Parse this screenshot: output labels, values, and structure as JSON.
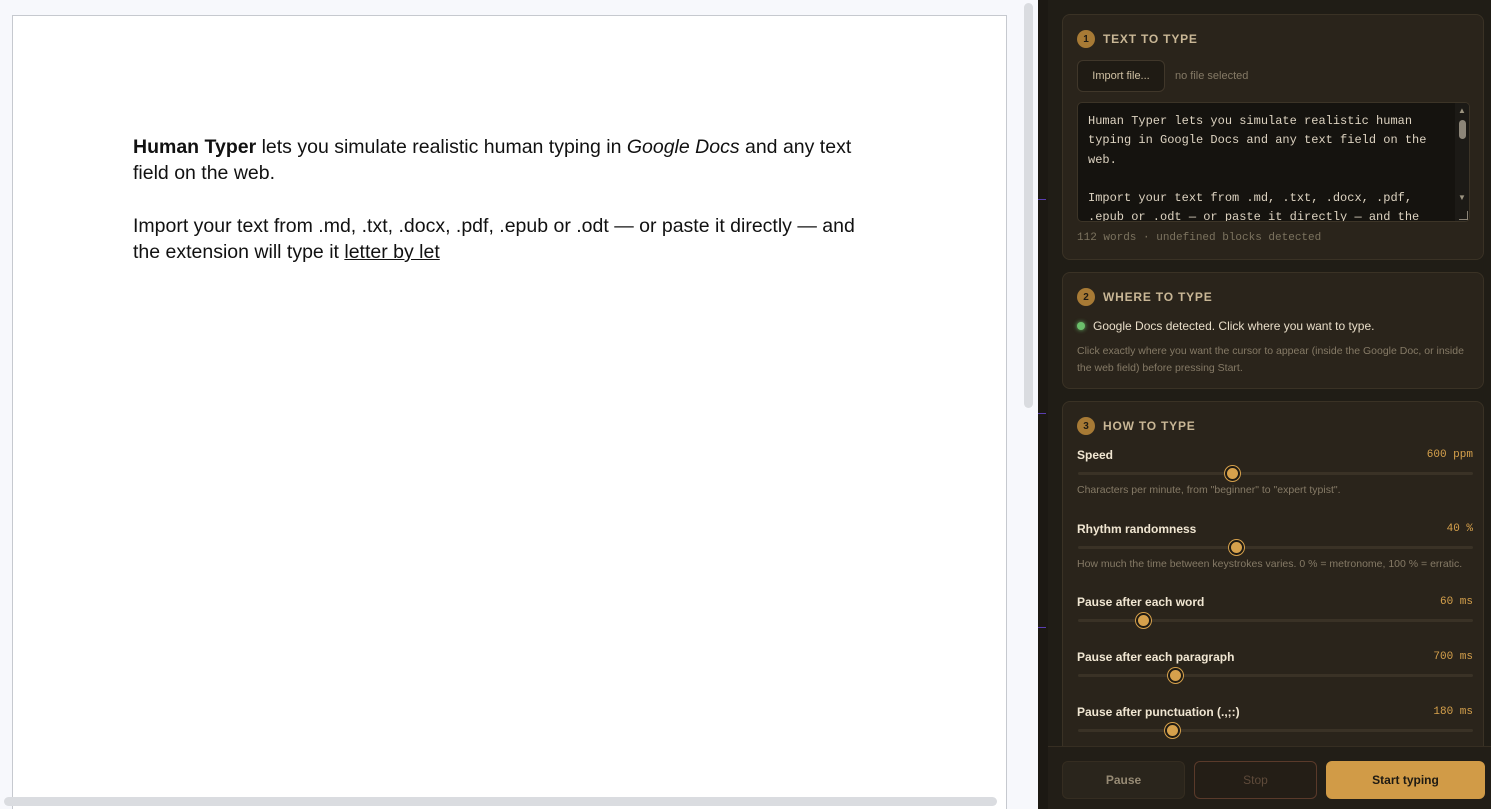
{
  "document": {
    "p1_bold": "Human Typer",
    "p1_mid": " lets you simulate realistic human typing in ",
    "p1_italic": "Google Docs",
    "p1_end": " and any text field on the web.",
    "p2_text": "Import your text from .md, .txt, .docx, .pdf, .epub or .odt — or paste it directly — and the extension will type it ",
    "p2_underlined": "letter by let"
  },
  "panel": {
    "section1": {
      "number": "1",
      "title": "TEXT TO TYPE",
      "import_button": "Import file...",
      "file_status": "no file selected",
      "textarea_value": "Human Typer lets you simulate realistic human typing in Google Docs and any text field on the web.\n\nImport your text from .md, .txt, .docx, .pdf, .epub or .odt — or paste it directly — and the",
      "word_count": "112 words · undefined blocks detected"
    },
    "section2": {
      "number": "2",
      "title": "WHERE TO TYPE",
      "status": "Google Docs detected. Click where you want to type.",
      "help": "Click exactly where you want the cursor to appear (inside the Google Doc, or inside the web field) before pressing Start."
    },
    "section3": {
      "number": "3",
      "title": "HOW TO TYPE",
      "settings": [
        {
          "label": "Speed",
          "value": "600 ppm",
          "fraction": 0.39,
          "help": "Characters per minute, from \"beginner\" to \"expert typist\"."
        },
        {
          "label": "Rhythm randomness",
          "value": "40 %",
          "fraction": 0.4,
          "help": "How much the time between keystrokes varies. 0 % = metronome, 100 % = erratic."
        },
        {
          "label": "Pause after each word",
          "value": "60 ms",
          "fraction": 0.165,
          "help": ""
        },
        {
          "label": "Pause after each paragraph",
          "value": "700 ms",
          "fraction": 0.245,
          "help": ""
        },
        {
          "label": "Pause after punctuation (.,;:)",
          "value": "180 ms",
          "fraction": 0.237,
          "help": ""
        }
      ]
    },
    "footer": {
      "pause": "Pause",
      "stop": "Stop",
      "start": "Start typing"
    }
  },
  "colors": {
    "accent": "#d19b47",
    "panel_bg": "#201d16",
    "status_ok": "#6bbf6b"
  }
}
